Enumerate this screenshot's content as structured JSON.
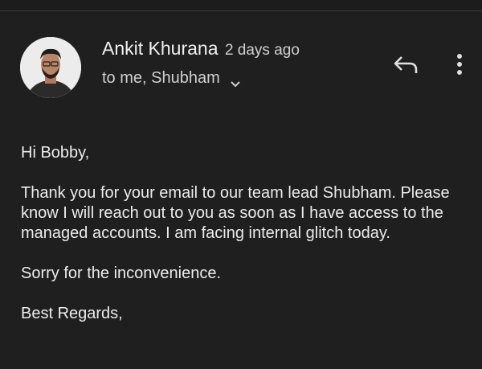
{
  "message": {
    "sender_name": "Ankit Khurana",
    "sent_time": "2 days ago",
    "recipients": "to me, Shubham",
    "icons": {
      "reply": "reply-icon",
      "more": "more-vert-icon",
      "expand": "chevron-down-icon"
    },
    "greeting": "Hi Bobby,",
    "paragraph_1": "Thank you for your email to our team lead Shubham. Please know I will reach out to you as soon as I have access to the managed accounts. I am facing internal glitch today.",
    "paragraph_2": "Sorry for the inconvenience.",
    "closing": "Best Regards,"
  },
  "colors": {
    "background": "#1f1f1f",
    "text": "#ececec",
    "secondary_text": "#cfcfcf"
  }
}
